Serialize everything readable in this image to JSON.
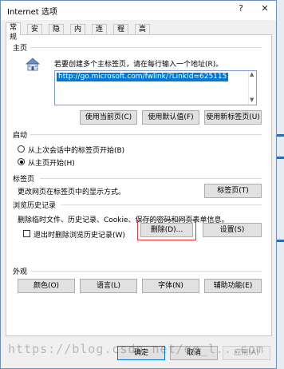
{
  "window": {
    "title": "Internet 选项",
    "help": "?",
    "close": "✕"
  },
  "tabs": [
    "常规",
    "安全",
    "隐私",
    "内容",
    "连接",
    "程序",
    "高级"
  ],
  "homepage": {
    "title": "主页",
    "prompt": "若要创建多个主标签页，请在每行输入一个地址(R)。",
    "url": "http://go.microsoft.com/fwlink/?LinkId=625115",
    "buttons": {
      "use_current": "使用当前页(C)",
      "use_default": "使用默认值(F)",
      "use_new_tab": "使用新标签页(U)"
    }
  },
  "startup": {
    "title": "启动",
    "option1": "从上次会话中的标签页开始(B)",
    "option2": "从主页开始(H)",
    "selected": "option2"
  },
  "tabs_section": {
    "title": "标签页",
    "desc": "更改网页在标签页中的显示方式。",
    "button": "标签页(T)"
  },
  "history": {
    "title": "浏览历史记录",
    "desc": "删除临时文件、历史记录、Cookie、保存的密码和网页表单信息。",
    "checkbox": "退出时删除浏览历史记录(W)",
    "checked": false,
    "delete_button": "删除(D)...",
    "settings_button": "设置(S)"
  },
  "appearance": {
    "title": "外观",
    "buttons": {
      "colors": "颜色(O)",
      "languages": "语言(L)",
      "fonts": "字体(N)",
      "accessibility": "辅助功能(E)"
    }
  },
  "footer": {
    "ok": "确定",
    "cancel": "取消",
    "apply": "应用(A)"
  },
  "watermark": "https://blog.csdn.net/qq_l...com"
}
